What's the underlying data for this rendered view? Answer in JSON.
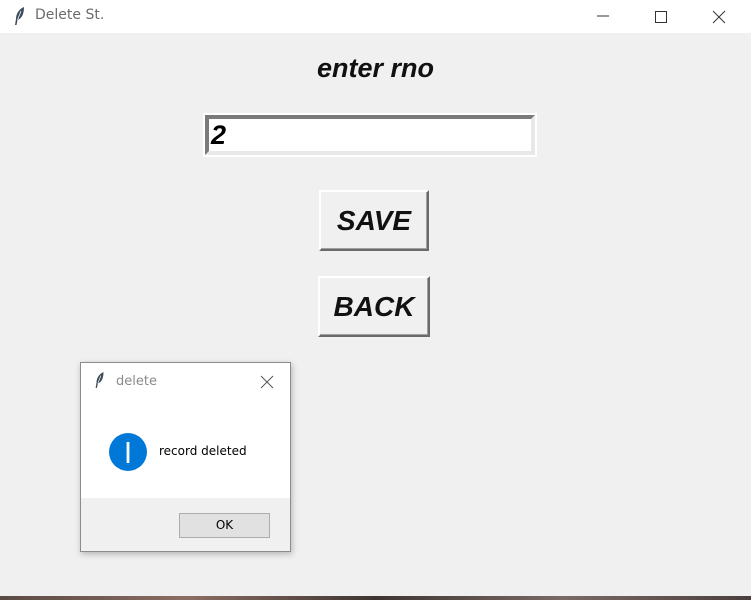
{
  "window": {
    "title": "Delete St.",
    "icon": "feather-icon"
  },
  "form": {
    "prompt": "enter rno",
    "rno_value": "2",
    "save_label": "SAVE",
    "back_label": "BACK"
  },
  "dialog": {
    "title": "delete",
    "icon": "info-icon",
    "message": "record deleted",
    "ok_label": "OK"
  },
  "colors": {
    "info_blue": "#0078d7",
    "background": "#f0f0f0"
  }
}
